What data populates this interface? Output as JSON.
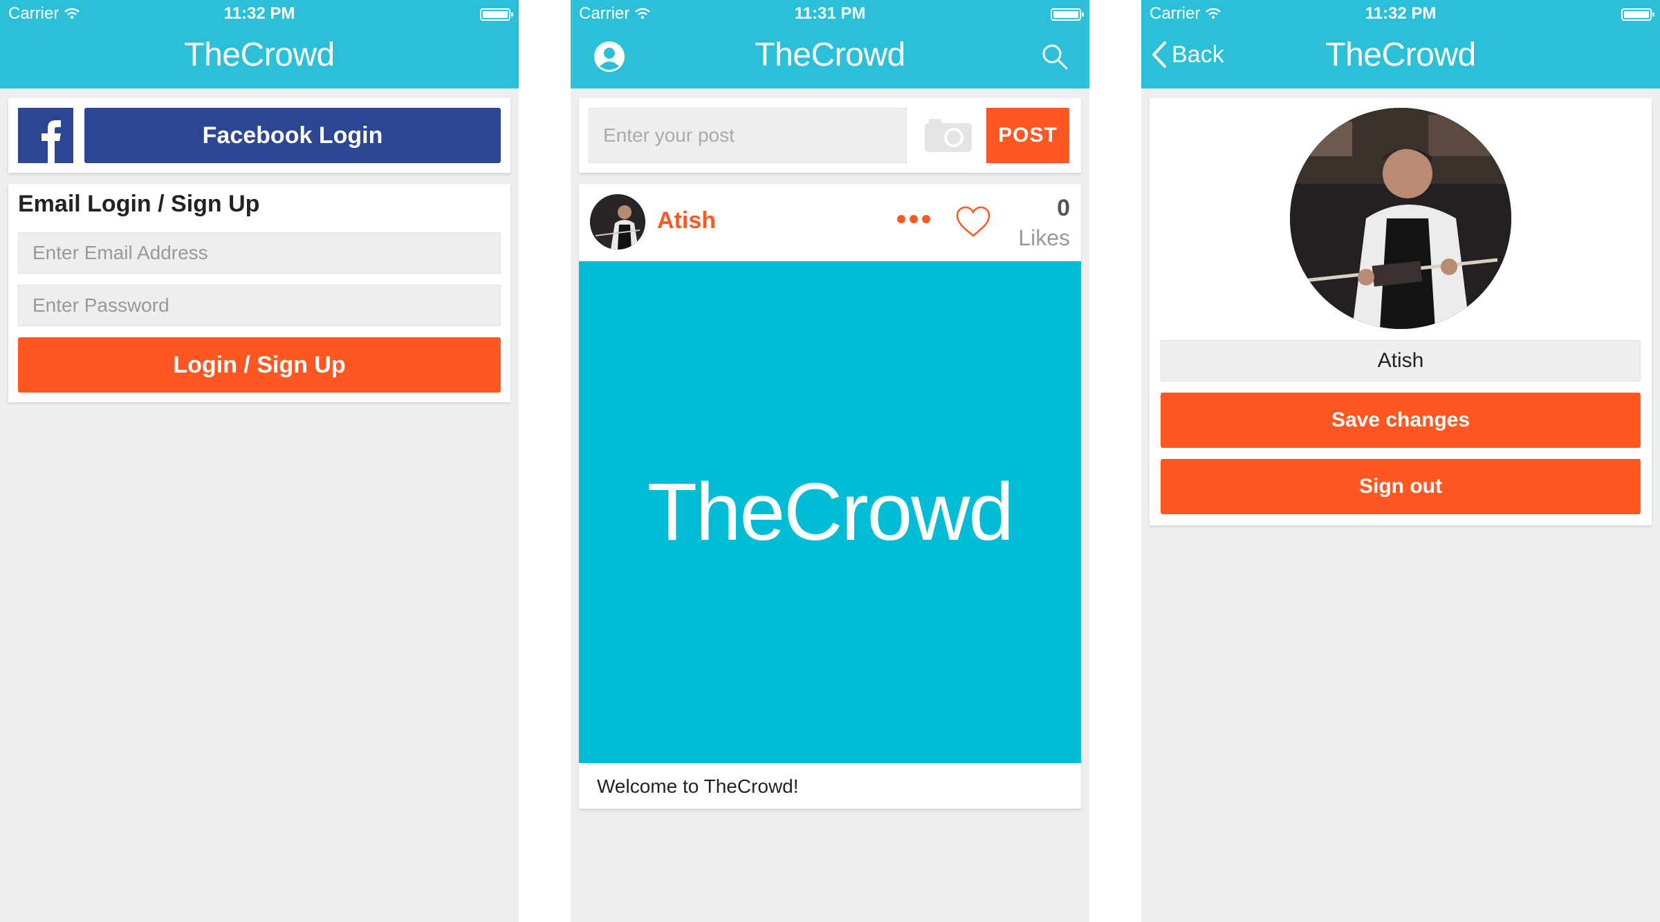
{
  "colors": {
    "nav_bar": "#2bc0d8",
    "accent_orange": "#fe5722",
    "facebook_blue": "#2d4694",
    "post_image_bg": "#00bcd5",
    "page_bg": "#eeeeee"
  },
  "screens": {
    "login": {
      "status": {
        "carrier": "Carrier",
        "time": "11:32 PM"
      },
      "nav_title": "TheCrowd",
      "facebook_button": "Facebook Login",
      "email_section_title": "Email Login / Sign Up",
      "email_placeholder": "Enter Email Address",
      "password_placeholder": "Enter Password",
      "submit_button": "Login / Sign Up"
    },
    "feed": {
      "status": {
        "carrier": "Carrier",
        "time": "11:31 PM"
      },
      "nav_title": "TheCrowd",
      "nav_left_icon": "profile-icon",
      "nav_right_icon": "search-icon",
      "post_placeholder": "Enter your post",
      "post_button": "POST",
      "post": {
        "author": "Atish",
        "likes_count": "0",
        "likes_label": "Likes",
        "image_text": "TheCrowd",
        "caption": "Welcome to TheCrowd!"
      }
    },
    "profile": {
      "status": {
        "carrier": "Carrier",
        "time": "11:32 PM"
      },
      "nav_title": "TheCrowd",
      "back_label": "Back",
      "name_value": "Atish",
      "save_button": "Save changes",
      "signout_button": "Sign out"
    }
  }
}
